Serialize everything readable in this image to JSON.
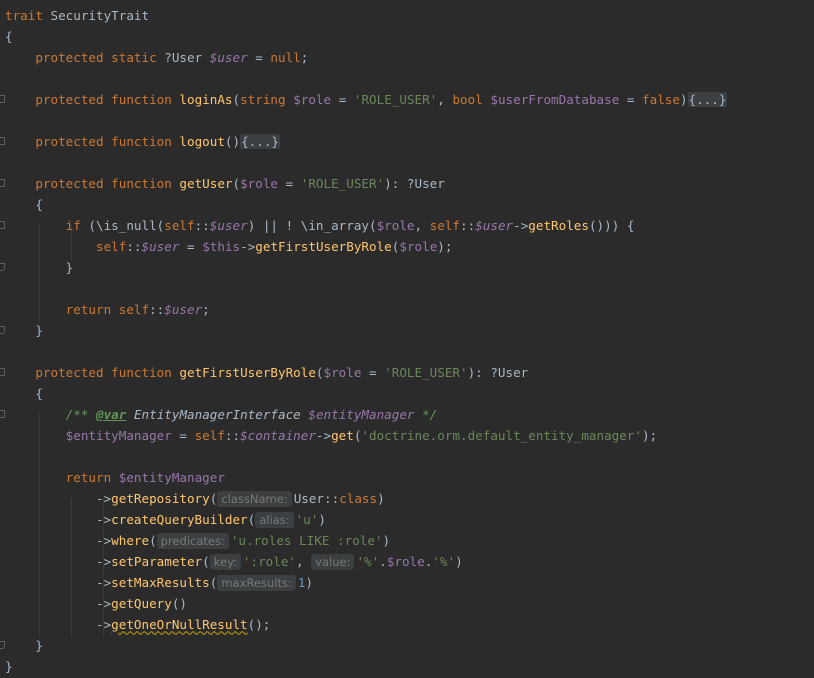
{
  "editor": {
    "language": "php",
    "colors": {
      "background": "#2b2b2b",
      "keyword": "#cc7832",
      "string": "#6a8759",
      "function": "#ffc66d",
      "variable": "#9876aa",
      "text": "#a9b7c6"
    },
    "lines": [
      {
        "text": "trait SecurityTrait"
      },
      {
        "text": "{"
      },
      {
        "text": "protected static ?User $user = null;"
      },
      {
        "text": ""
      },
      {
        "text": "protected function loginAs(string $role = 'ROLE_USER', bool $userFromDatabase = false){...}"
      },
      {
        "text": ""
      },
      {
        "text": "protected function logout(){...}"
      },
      {
        "text": ""
      },
      {
        "text": "protected function getUser($role = 'ROLE_USER'): ?User"
      },
      {
        "text": "{"
      },
      {
        "text": "if (\\is_null(self::$user) || ! \\in_array($role, self::$user->getRoles())) {"
      },
      {
        "text": "self::$user = $this->getFirstUserByRole($role);"
      },
      {
        "text": "}"
      },
      {
        "text": ""
      },
      {
        "text": "return self::$user;"
      },
      {
        "text": "}"
      },
      {
        "text": ""
      },
      {
        "text": "protected function getFirstUserByRole($role = 'ROLE_USER'): ?User"
      },
      {
        "text": "{"
      },
      {
        "text": "/** @var EntityManagerInterface $entityManager */"
      },
      {
        "text": "$entityManager = self::$container->get('doctrine.orm.default_entity_manager');"
      },
      {
        "text": ""
      },
      {
        "text": "return $entityManager"
      },
      {
        "text": "->getRepository(className: User::class)"
      },
      {
        "text": "->createQueryBuilder(alias: 'u')"
      },
      {
        "text": "->where(predicates: 'u.roles LIKE :role')"
      },
      {
        "text": "->setParameter(key: ':role', value: '%'.$role.'%')"
      },
      {
        "text": "->setMaxResults(maxResults: 1)"
      },
      {
        "text": "->getQuery()"
      },
      {
        "text": "->getOneOrNullResult();"
      },
      {
        "text": "}"
      },
      {
        "text": "}"
      }
    ],
    "hints": {
      "className": "className:",
      "alias": "alias:",
      "predicates": "predicates:",
      "key": "key:",
      "value": "value:",
      "maxResults": "maxResults:"
    },
    "folded": "{...}"
  }
}
